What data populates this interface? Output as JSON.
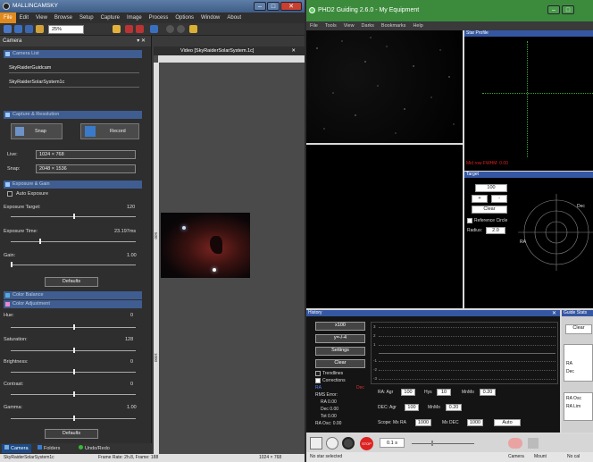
{
  "left_app": {
    "title": "MALLINCAMSKY",
    "menu": [
      "File",
      "Edit",
      "View",
      "Browse",
      "Setup",
      "Capture",
      "Image",
      "Process",
      "Options",
      "Window",
      "About"
    ],
    "zoom": "25%",
    "panel_title": "Camera",
    "video_tab": "Video [SkyRaiderSolarSystem.1c]",
    "sections": {
      "camera_list": "Camera List",
      "capture": "Capture & Resolution",
      "exposure": "Exposure & Gain",
      "color_balance": "Color Balance",
      "color_adjustment": "Color Adjustment"
    },
    "cameras": [
      "SkyRaiderGuidcam",
      "SkyRaiderSolarSystem1c"
    ],
    "snap_label": "Snap",
    "record_label": "Record",
    "live_label": "Live:",
    "live_value": "1024 × 768",
    "snap_res_label": "Snap:",
    "snap_res_value": "2048 × 1536",
    "auto_exposure": "Auto Exposure",
    "exposure_target_label": "Exposure Target:",
    "exposure_target_value": "120",
    "exposure_time_label": "Exposure Time:",
    "exposure_time_value": "23.197ms",
    "gain_label": "Gain:",
    "gain_value": "1.00",
    "defaults": "Defaults",
    "hue_label": "Hue:",
    "hue_value": "0",
    "saturation_label": "Saturation:",
    "saturation_value": "128",
    "brightness_label": "Brightness:",
    "brightness_value": "0",
    "contrast_label": "Contrast:",
    "contrast_value": "0",
    "gamma_label": "Gamma:",
    "gamma_value": "1.00",
    "tabs": [
      "Camera",
      "Folders",
      "Undo/Redo"
    ],
    "status_left": "SkyRaiderSolarSystem1c",
    "status_mid": "Frame Rate: 2h.8, Frame: 188",
    "status_right": "1024 × 768",
    "ruler_marks": [
      "0",
      "500",
      "1000",
      "1500"
    ]
  },
  "phd": {
    "title": "PHD2 Guiding 2.6.0 - My Equipment",
    "menu": [
      "File",
      "Tools",
      "View",
      "Darks",
      "Bookmarks",
      "Help"
    ],
    "star_profile": "Star Profile",
    "no_star": "Mid row FWHM: 0.00",
    "target": "Target",
    "target_scale": "100",
    "plus": "+",
    "minus": "-",
    "clear": "Clear",
    "reference_circle": "Reference Circle",
    "radius_label": "Radius:",
    "radius_value": "2.0",
    "ra_label": "RA",
    "dec_label": "Dec",
    "history": "History",
    "history_scale": "x100",
    "history_axis": "y=-/-4",
    "settings": "Settings",
    "trendlines": "Trendlines",
    "corrections": "Corrections",
    "ra_legend": "RA",
    "dec_legend": "Dec",
    "rms_error": "RMS Error:",
    "ra_rms": "RA 0.00",
    "dec_rms": "Dec 0.00",
    "tot_rms": "Tot 0.00",
    "ra_osc": "RA Osc: 0.00",
    "ra_agr_label": "RA: Agr",
    "ra_agr": "100",
    "hys_label": "Hys",
    "hys": "10",
    "mnmo_label": "MnMo",
    "mnmo": "0.20",
    "dec_agr_label": "DEC: Agr",
    "dec_agr": "100",
    "dec_mnmo": "0.20",
    "scope_label": "Scope: Mx RA",
    "mx_ra": "1000",
    "mx_dec_label": "Mx DEC",
    "mx_dec": "1000",
    "dec_mode": "Auto",
    "guide_stats": "Guide Stats",
    "exposure_sel": "0.1 s",
    "status_left": "No star selected",
    "status_camera": "Camera",
    "status_mount": "Mount",
    "status_cal": "No cal",
    "graph_labels": [
      "3",
      "2",
      "1",
      "-1",
      "-2",
      "-3"
    ],
    "stats_ra": "RA",
    "stats_dec": "Dec",
    "stats_ra_osc": "RA Osc",
    "stats_ra_lim": "RA Lim"
  }
}
